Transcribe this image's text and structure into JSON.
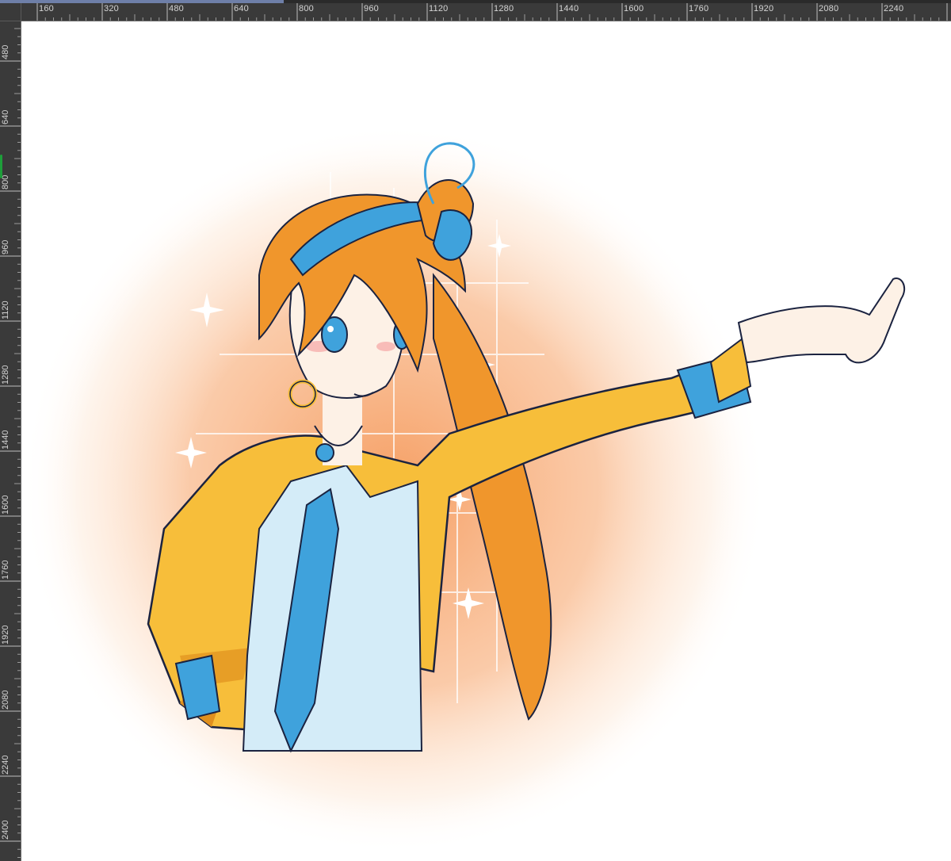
{
  "top_strip": {
    "selected_color": "#6e7fa8"
  },
  "ruler_horizontal": {
    "labels": [
      "160",
      "320",
      "480",
      "640",
      "800",
      "960",
      "1120",
      "1280",
      "1440",
      "1600",
      "1760",
      "1920",
      "2080",
      "2240"
    ]
  },
  "ruler_vertical": {
    "labels": [
      "480",
      "640",
      "800",
      "960",
      "1120",
      "1280",
      "1440",
      "1600",
      "1760",
      "1920",
      "2080",
      "2240",
      "2400"
    ]
  },
  "canvas": {
    "background": "#ffffff",
    "artwork": "character-illustration"
  },
  "colors": {
    "hair": "#f0962c",
    "jacket": "#f7be3a",
    "jacket_shadow": "#e0901e",
    "shirt": "#d4ecf8",
    "tie": "#3fa2dc",
    "glow": "#f8b07a",
    "skin": "#fdf1e6",
    "line": "#1b2340"
  }
}
